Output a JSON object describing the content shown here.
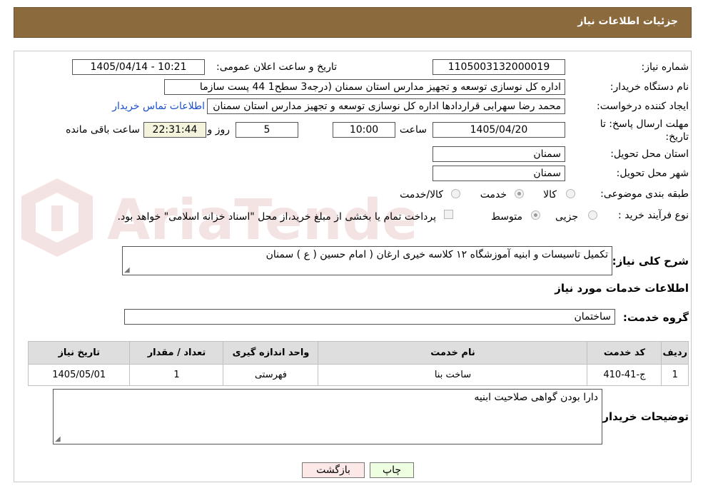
{
  "header": {
    "title": "جزئیات اطلاعات نیاز"
  },
  "watermark": {
    "text": "AriaTender.neT",
    "color": "#b03030"
  },
  "form": {
    "need_number_label": "شماره نیاز:",
    "need_number": "1105003132000019",
    "announce_label": "تاریخ و ساعت اعلان عمومی:",
    "announce_value": "1405/04/14 - 10:21",
    "buyer_label": "نام دستگاه خریدار:",
    "buyer_value": "اداره کل نوسازی   توسعه و تجهیز مدارس استان سمنان (درجه3  سطح1  44 پست سازما",
    "creator_label": "ایجاد کننده درخواست:",
    "creator_value": "محمد رضا سهرابی قراردادها اداره کل نوسازی   توسعه و تجهیز مدارس استان سمنان",
    "contact_link": "اطلاعات تماس خریدار",
    "deadline_label": "مهلت ارسال پاسخ: تا تاریخ:",
    "deadline_date": "1405/04/20",
    "time_label": "ساعت",
    "deadline_time": "10:00",
    "days_value": "5",
    "days_label": "روز و",
    "remaining_value": "22:31:44",
    "remaining_label": "ساعت باقی مانده",
    "province_label": "استان محل تحویل:",
    "province_value": "سمنان",
    "city_label": "شهر محل تحویل:",
    "city_value": "سمنان",
    "category_label": "طبقه بندی موضوعی:",
    "category_options": [
      "کالا",
      "خدمت",
      "کالا/خدمت"
    ],
    "category_selected": "خدمت",
    "process_label": "نوع فرآیند خرید :",
    "process_options": [
      "جزیی",
      "متوسط"
    ],
    "process_selected": "متوسط",
    "payment_note": "پرداخت تمام یا بخشی از مبلغ خرید،از محل \"اسناد خزانه اسلامی\" خواهد بود.",
    "description_label": "شرح کلی نیاز:",
    "description_value": "تکمیل تاسیسات و ابنیه آموزشگاه ۱۲ کلاسه خیری ارغان ( امام حسین ( ع ) سمنان"
  },
  "services": {
    "section_title": "اطلاعات خدمات مورد نیاز",
    "group_label": "گروه خدمت:",
    "group_value": "ساختمان",
    "columns": [
      "ردیف",
      "کد خدمت",
      "نام خدمت",
      "واحد اندازه گیری",
      "تعداد / مقدار",
      "تاریخ نیاز"
    ],
    "rows": [
      [
        "1",
        "ج-41-410",
        "ساخت بنا",
        "فهرستی",
        "1",
        "1405/05/01"
      ]
    ]
  },
  "buyer_notes": {
    "label": "توضیحات خریدار:",
    "value": "دارا بودن گواهی صلاحیت ابنیه"
  },
  "buttons": {
    "print": "چاپ",
    "back": "بازگشت",
    "print_color": "#eefee0",
    "back_color": "#fde8e8"
  }
}
